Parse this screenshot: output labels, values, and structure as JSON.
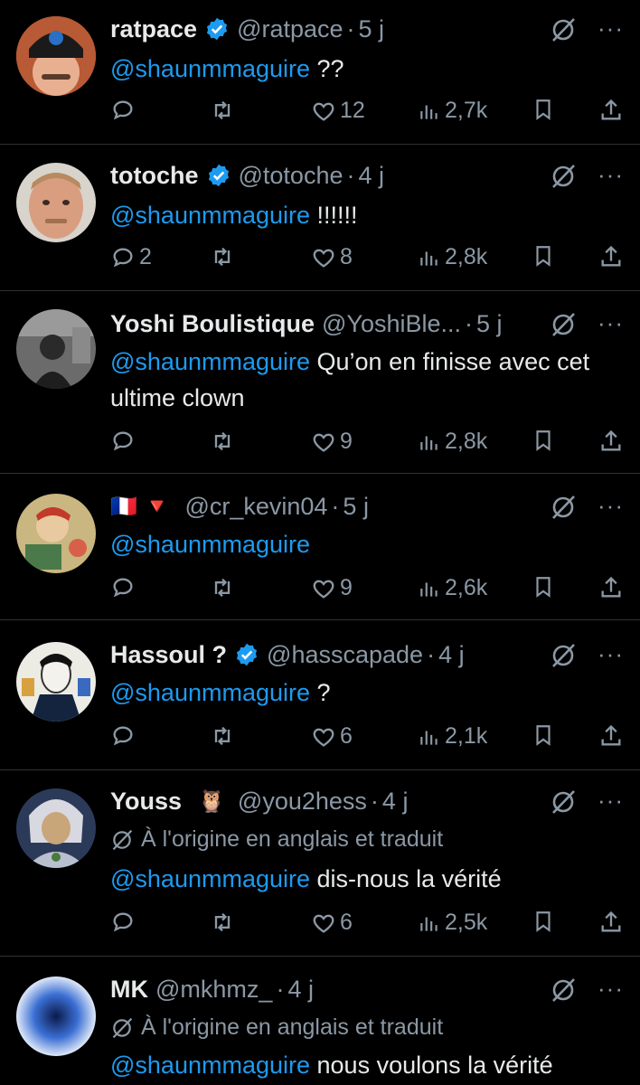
{
  "colors": {
    "background": "#000000",
    "mention": "#1d9bf0",
    "muted": "#8b98a5",
    "text": "#e7e9ea",
    "divider": "#2f3336",
    "verified": "#1d9bf0"
  },
  "replies": [
    {
      "name": "ratpace",
      "verified": true,
      "handle": "@ratpace",
      "time": "5 j",
      "mention": "@shaunmmaguire",
      "text": " ??",
      "replies": "",
      "likes": "12",
      "views": "2,7k",
      "avatar_color": "#2a70c4"
    },
    {
      "name": "totoche",
      "verified": true,
      "handle": "@totoche",
      "time": "4 j",
      "mention": "@shaunmmaguire",
      "text": " !!!!!!",
      "replies": "2",
      "likes": "8",
      "views": "2,8k",
      "avatar_color": "#c7a18a"
    },
    {
      "name": "Yoshi Boulistique",
      "verified": false,
      "handle": "@YoshiBle...",
      "time": "5 j",
      "mention": "@shaunmmaguire",
      "text": " Qu’on en finisse avec cet ultime clown",
      "replies": "",
      "likes": "9",
      "views": "2,8k",
      "avatar_color": "#555555"
    },
    {
      "name": "",
      "name_emoji": "🇫🇷 🔻",
      "verified": false,
      "handle": "@cr_kevin04",
      "time": "5 j",
      "mention": "@shaunmmaguire",
      "text": "",
      "replies": "",
      "likes": "9",
      "views": "2,6k",
      "avatar_color": "#b5a070"
    },
    {
      "name": "Hassoul ?",
      "verified": true,
      "handle": "@hasscapade",
      "time": "4 j",
      "mention": "@shaunmmaguire",
      "text": " ?",
      "replies": "",
      "likes": "6",
      "views": "2,1k",
      "avatar_color": "#e0ddd0"
    },
    {
      "name": "Youss",
      "name_emoji": "🦉",
      "verified": false,
      "handle": "@you2hess",
      "time": "4 j",
      "translated": "À l'origine en anglais et traduit",
      "mention": "@shaunmmaguire",
      "text": " dis-nous la vérité",
      "replies": "",
      "likes": "6",
      "views": "2,5k",
      "avatar_color": "#3a4a6a"
    },
    {
      "name": "MK",
      "verified": false,
      "handle": "@mkhmz_",
      "time": "4 j",
      "translated": "À l'origine en anglais et traduit",
      "mention": "@shaunmmaguire",
      "text": " nous voulons la vérité",
      "replies": "",
      "likes": "",
      "views": "",
      "avatar_color": "#3b6fd4"
    }
  ]
}
